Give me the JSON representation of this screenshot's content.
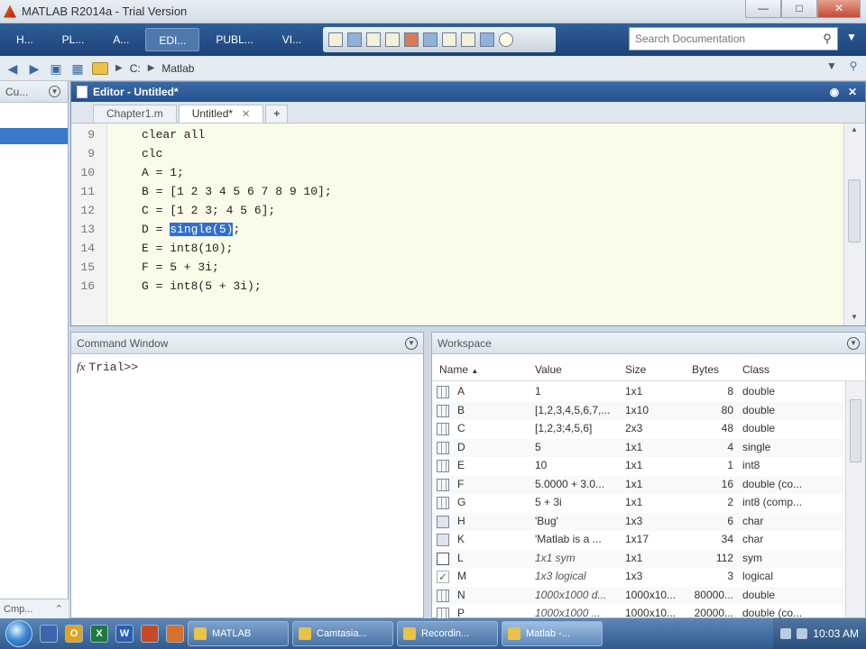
{
  "window": {
    "title": "MATLAB R2014a - Trial Version"
  },
  "toolstrip": {
    "tabs": [
      "H...",
      "PL...",
      "A...",
      "EDI...",
      "PUBL...",
      "VI..."
    ],
    "active_tab": 3,
    "search_placeholder": "Search Documentation"
  },
  "address": {
    "path": [
      "C:",
      "Matlab"
    ]
  },
  "current_folder": {
    "title": "Cu...",
    "footer": "Cmp..."
  },
  "editor": {
    "title": "Editor - Untitled*",
    "tabs": [
      "Chapter1.m",
      "Untitled*"
    ],
    "lines": [
      {
        "n": "9",
        "code": "clear all"
      },
      {
        "n": "9",
        "code": "clc"
      },
      {
        "n": "10",
        "code": "A = 1;"
      },
      {
        "n": "11",
        "code": "B = [1 2 3 4 5 6 7 8 9 10];"
      },
      {
        "n": "12",
        "code": "C = [1 2 3; 4 5 6];"
      },
      {
        "n": "13",
        "code_pre": "D = ",
        "code_sel": "single(5)",
        "code_post": ";"
      },
      {
        "n": "14",
        "code": "E = int8(10);"
      },
      {
        "n": "15",
        "code": "F = 5 + 3i;"
      },
      {
        "n": "16",
        "code": "G = int8(5 + 3i);"
      }
    ]
  },
  "command_window": {
    "title": "Command Window",
    "prompt": "Trial>>"
  },
  "workspace": {
    "title": "Workspace",
    "columns": [
      "Name",
      "Value",
      "Size",
      "Bytes",
      "Class"
    ],
    "rows": [
      {
        "name": "A",
        "value": "1",
        "size": "1x1",
        "bytes": "8",
        "class": "double",
        "icon": "grid"
      },
      {
        "name": "B",
        "value": "[1,2,3,4,5,6,7,...",
        "size": "1x10",
        "bytes": "80",
        "class": "double",
        "icon": "grid"
      },
      {
        "name": "C",
        "value": "[1,2,3;4,5,6]",
        "size": "2x3",
        "bytes": "48",
        "class": "double",
        "icon": "grid"
      },
      {
        "name": "D",
        "value": "5",
        "size": "1x1",
        "bytes": "4",
        "class": "single",
        "icon": "grid"
      },
      {
        "name": "E",
        "value": "10",
        "size": "1x1",
        "bytes": "1",
        "class": "int8",
        "icon": "grid"
      },
      {
        "name": "F",
        "value": "5.0000 + 3.0...",
        "size": "1x1",
        "bytes": "16",
        "class": "double (co...",
        "icon": "grid"
      },
      {
        "name": "G",
        "value": "5 + 3i",
        "size": "1x1",
        "bytes": "2",
        "class": "int8 (comp...",
        "icon": "grid"
      },
      {
        "name": "H",
        "value": "'Bug'",
        "size": "1x3",
        "bytes": "6",
        "class": "char",
        "icon": "str"
      },
      {
        "name": "K",
        "value": "'Matlab is a ...",
        "size": "1x17",
        "bytes": "34",
        "class": "char",
        "icon": "str"
      },
      {
        "name": "L",
        "value": "1x1 sym",
        "size": "1x1",
        "bytes": "112",
        "class": "sym",
        "icon": "sym"
      },
      {
        "name": "M",
        "value": "1x3 logical",
        "size": "1x3",
        "bytes": "3",
        "class": "logical",
        "icon": "chk"
      },
      {
        "name": "N",
        "value": "1000x1000 d...",
        "size": "1000x10...",
        "bytes": "80000...",
        "class": "double",
        "icon": "grid"
      },
      {
        "name": "P",
        "value": "1000x1000 ...",
        "size": "1000x10...",
        "bytes": "20000...",
        "class": "double (co...",
        "icon": "grid"
      }
    ]
  },
  "taskbar": {
    "buttons": [
      "MATLAB",
      "Camtasia...",
      "Recordin...",
      "Matlab -..."
    ],
    "active_button": 3,
    "clock": "10:03 AM"
  }
}
